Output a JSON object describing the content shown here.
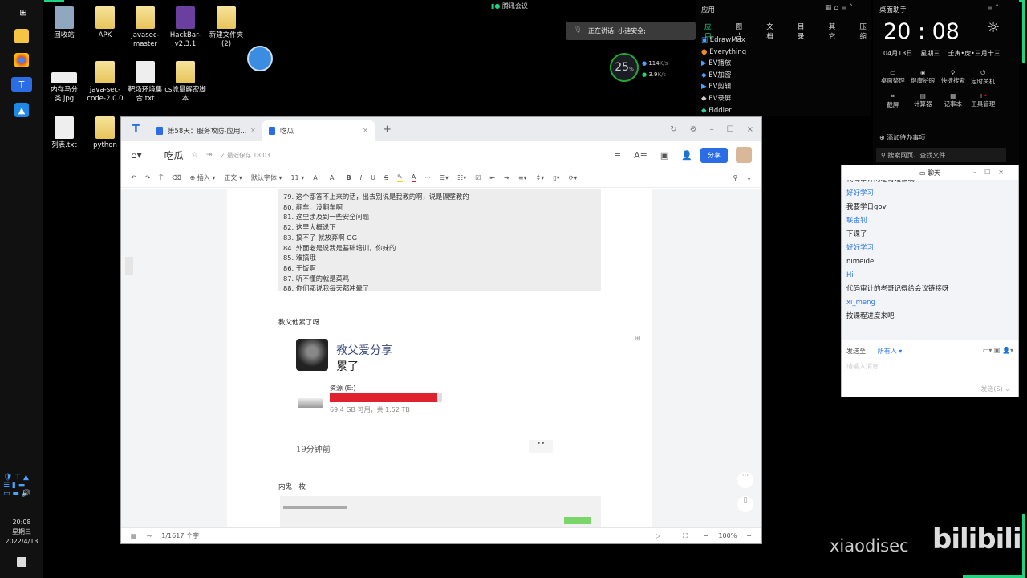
{
  "desktop": {
    "icons": [
      "回收站",
      "APK",
      "javasec-master",
      "HackBar-v2.3.1",
      "新建文件夹\n(2)",
      "内存马分类.jpg",
      "java-sec-code-2.0.0",
      "靶场环境集合.txt",
      "cs流量解密脚本",
      "列表.txt",
      "python"
    ]
  },
  "taskbar": {
    "time": "20:08",
    "weekday": "星期三",
    "date": "2022/4/13"
  },
  "meeting": {
    "app": "腾讯会议",
    "speaking": "正在讲话: 小迪安全;"
  },
  "monitor": {
    "cpu": "25",
    "cpu_unit": "%",
    "up": "114",
    "up_unit": "K/s",
    "down": "3.9",
    "down_unit": "K/s"
  },
  "apps_panel": {
    "title": "应用",
    "tabs": [
      "应用",
      "图片",
      "文档",
      "目录",
      "其它",
      "压缩"
    ],
    "items": [
      "EdrawMax",
      "Everything",
      "EV播放",
      "EV加密",
      "EV剪辑",
      "EV录屏",
      "Fiddler"
    ]
  },
  "assistant": {
    "title": "桌面助手",
    "time": "20 : 08",
    "date": "04月13日",
    "weekday": "星期三",
    "lunar": "壬寅•虎•三月十三",
    "tools": [
      "桌面整理",
      "健康护眼",
      "快捷搜索",
      "定时关机",
      "截屏",
      "计算器",
      "记事本",
      "工具管理"
    ],
    "todo": "添加待办事项",
    "search_placeholder": "搜索网页、查找文件"
  },
  "editor": {
    "tabs": [
      "第58天：服务攻防-应用...",
      "吃瓜"
    ],
    "doc_title": "吃瓜",
    "saved": "最近保存 18:03",
    "share": "分享",
    "toolbar": {
      "insert": "插入",
      "style": "正文",
      "font": "默认字体",
      "size": "11"
    },
    "code_lines": [
      "79. 这个都答不上来的话，出去别说是我教的啊，说是隔壁教的",
      "80. 翻车，没翻车啊",
      "81. 这里涉及到一些安全问题",
      "82. 这里大概说下",
      "83. 搞不了 就放弃啊 GG",
      "84. 外面老是说我是基础培训，你妹的",
      "85. 难搞哦",
      "86. 干饭啊",
      "87. 听不懂的就是菜鸡",
      "88. 你们都说我每天都冲晕了"
    ],
    "para1": "教父他累了呀",
    "meme_name": "教父爱分享",
    "meme_text": "累了",
    "drive_label": "资源 (E:)",
    "drive_usage": 0.955,
    "drive_free": "69.4 GB 可用，共 1.52 TB",
    "meme_time": "19分钟前",
    "para2": "内鬼一枚",
    "wordcount": "1/1617 个字",
    "zoom": "100%"
  },
  "chat": {
    "title": "聊天",
    "messages": [
      {
        "name": "",
        "text": "代码审计的老哥是谁啊"
      },
      {
        "name": "好好学习",
        "text": "我要学日gov"
      },
      {
        "name": "联金钊",
        "text": "下课了"
      },
      {
        "name": "好好学习",
        "text": "nimeide"
      },
      {
        "name": "Hi",
        "text": "代码审计的老哥记得给会议链接呀"
      },
      {
        "name": "xi_meng",
        "text": "按课程进度来吧"
      }
    ],
    "send_to_label": "发送至:",
    "send_to": "所有人",
    "input_placeholder": "请输入消息...",
    "send": "发送(S)"
  },
  "watermark": {
    "user": "xiaodisec",
    "logo": "bilibili"
  },
  "colors": {
    "accent": "#2b6de5",
    "frame": "#1ed47e",
    "drive_bar": "#e0212e"
  }
}
